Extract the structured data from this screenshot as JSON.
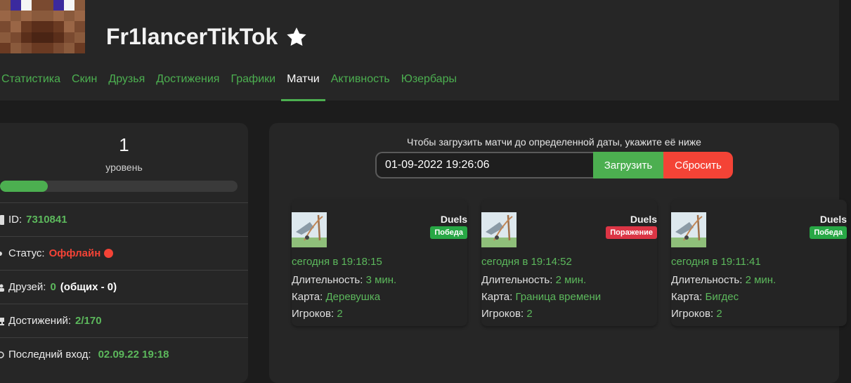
{
  "profile": {
    "username": "Fr1lancerTikTok",
    "star_icon": "star-icon"
  },
  "nav": {
    "items": [
      {
        "label": "Статистика",
        "active": false
      },
      {
        "label": "Скин",
        "active": false
      },
      {
        "label": "Друзья",
        "active": false
      },
      {
        "label": "Достижения",
        "active": false
      },
      {
        "label": "Графики",
        "active": false
      },
      {
        "label": "Матчи",
        "active": true
      },
      {
        "label": "Активность",
        "active": false
      },
      {
        "label": "Юзербары",
        "active": false
      }
    ]
  },
  "sidebar": {
    "level_value": "1",
    "level_label": "уровень",
    "level_progress": 0.2,
    "stats": {
      "id_label": "ID:",
      "id_value": "7310841",
      "status_label": "Статус:",
      "status_value": "Оффлайн",
      "friends_label": "Друзей:",
      "friends_count": "0",
      "friends_common": "(общих - 0)",
      "achievements_label": "Достижений:",
      "achievements_value": "2/170",
      "last_login_label": "Последний вход:",
      "last_login_value": "02.09.22 19:18"
    }
  },
  "matches_panel": {
    "hint": "Чтобы загрузить матчи до определенной даты, укажите её ниже",
    "date_value": "01-09-2022 19:26:06",
    "load_button": "Загрузить",
    "reset_button": "Сбросить",
    "duration_label": "Длительность:",
    "map_label": "Карта:",
    "players_label": "Игроков:",
    "matches": [
      {
        "mode": "Duels",
        "result": "Победа",
        "result_type": "win",
        "time": "сегодня в 19:18:15",
        "duration": "3 мин.",
        "map": "Деревушка",
        "players": "2"
      },
      {
        "mode": "Duels",
        "result": "Поражение",
        "result_type": "loss",
        "time": "сегодня в 19:14:52",
        "duration": "2 мин.",
        "map": "Граница времени",
        "players": "2"
      },
      {
        "mode": "Duels",
        "result": "Победа",
        "result_type": "win",
        "time": "сегодня в 19:11:41",
        "duration": "2 мин.",
        "map": "Бигдес",
        "players": "2"
      }
    ]
  },
  "colors": {
    "accent_green": "#4caf50",
    "danger_red": "#f44336",
    "win_badge": "#28a745",
    "loss_badge": "#dc3545"
  }
}
